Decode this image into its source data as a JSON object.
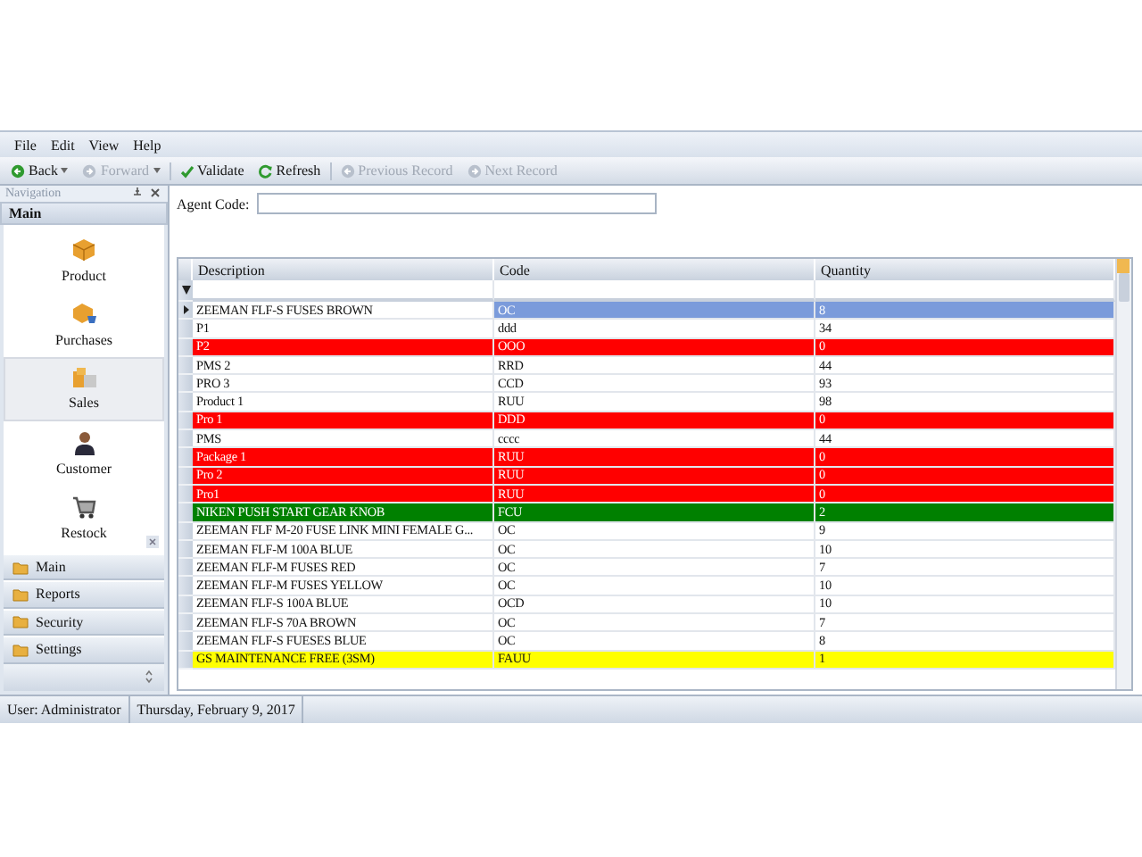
{
  "menu": [
    "File",
    "Edit",
    "View",
    "Help"
  ],
  "toolbar": [
    {
      "kind": "back",
      "label": "Back",
      "dropdown": true,
      "disabled": false
    },
    {
      "kind": "forward",
      "label": "Forward",
      "dropdown": true,
      "disabled": true
    },
    {
      "kind": "check",
      "label": "Validate",
      "dropdown": false,
      "disabled": false
    },
    {
      "kind": "refresh",
      "label": "Refresh",
      "dropdown": false,
      "disabled": false
    },
    {
      "kind": "prev",
      "label": "Previous Record",
      "dropdown": false,
      "disabled": true
    },
    {
      "kind": "next",
      "label": "Next Record",
      "dropdown": false,
      "disabled": true
    }
  ],
  "navigation": {
    "title": "Navigation",
    "group": "Main",
    "items": [
      {
        "kind": "box",
        "label": "Product",
        "selected": false
      },
      {
        "kind": "cart",
        "label": "Purchases",
        "selected": false
      },
      {
        "kind": "boxes",
        "label": "Sales",
        "selected": true
      },
      {
        "kind": "person",
        "label": "Customer",
        "selected": false
      },
      {
        "kind": "trolley",
        "label": "Restock",
        "selected": false
      }
    ],
    "groups": [
      "Main",
      "Reports",
      "Security",
      "Settings"
    ]
  },
  "agent_code": {
    "label": "Agent Code:"
  },
  "table": {
    "columns": [
      "Description",
      "Code",
      "Quantity"
    ],
    "rows": [
      {
        "cells": [
          "ZEEMAN FLF-S FUSES BROWN",
          "OC",
          "8"
        ],
        "color": "#ffffff",
        "selected": true
      },
      {
        "cells": [
          "P1",
          "ddd",
          "34"
        ],
        "color": "#ffffff",
        "selected": false
      },
      {
        "cells": [
          "P2",
          "OOO",
          "0"
        ],
        "color": "#ff0000",
        "selected": false
      },
      {
        "cells": [
          "PMS 2",
          "RRD",
          "44"
        ],
        "color": "#ffffff",
        "selected": false
      },
      {
        "cells": [
          "PRO 3",
          "CCD",
          "93"
        ],
        "color": "#ffffff",
        "selected": false
      },
      {
        "cells": [
          "Product 1",
          "RUU",
          "98"
        ],
        "color": "#ffffff",
        "selected": false
      },
      {
        "cells": [
          "Pro 1",
          "DDD",
          "0"
        ],
        "color": "#ff0000",
        "selected": false
      },
      {
        "cells": [
          "PMS",
          "cccc",
          "44"
        ],
        "color": "#ffffff",
        "selected": false
      },
      {
        "cells": [
          "Package 1",
          "RUU",
          "0"
        ],
        "color": "#ff0000",
        "selected": false
      },
      {
        "cells": [
          "Pro 2",
          "RUU",
          "0"
        ],
        "color": "#ff0000",
        "selected": false
      },
      {
        "cells": [
          "Pro1",
          "RUU",
          "0"
        ],
        "color": "#ff0000",
        "selected": false
      },
      {
        "cells": [
          "NIKEN PUSH START GEAR KNOB",
          "FCU",
          "2"
        ],
        "color": "#008000",
        "selected": false
      },
      {
        "cells": [
          "ZEEMAN FLF M-20 FUSE LINK MINI FEMALE G...",
          "OC",
          "9"
        ],
        "color": "#ffffff",
        "selected": false
      },
      {
        "cells": [
          "ZEEMAN FLF-M 100A BLUE",
          "OC",
          "10"
        ],
        "color": "#ffffff",
        "selected": false
      },
      {
        "cells": [
          "ZEEMAN FLF-M FUSES RED",
          "OC",
          "7"
        ],
        "color": "#ffffff",
        "selected": false
      },
      {
        "cells": [
          "ZEEMAN FLF-M FUSES YELLOW",
          "OC",
          "10"
        ],
        "color": "#ffffff",
        "selected": false
      },
      {
        "cells": [
          "ZEEMAN FLF-S 100A BLUE",
          "OCD",
          "10"
        ],
        "color": "#ffffff",
        "selected": false
      },
      {
        "cells": [
          "ZEEMAN FLF-S 70A BROWN",
          "OC",
          "7"
        ],
        "color": "#ffffff",
        "selected": false
      },
      {
        "cells": [
          "ZEEMAN FLF-S FUESES BLUE",
          "OC",
          "8"
        ],
        "color": "#ffffff",
        "selected": false
      },
      {
        "cells": [
          "GS MAINTENANCE FREE (3SM)",
          "FAUU",
          "1"
        ],
        "color": "#ffff00",
        "selected": false
      }
    ]
  },
  "status_bar": [
    "User: Administrator",
    "Thursday, February 9, 2017"
  ]
}
